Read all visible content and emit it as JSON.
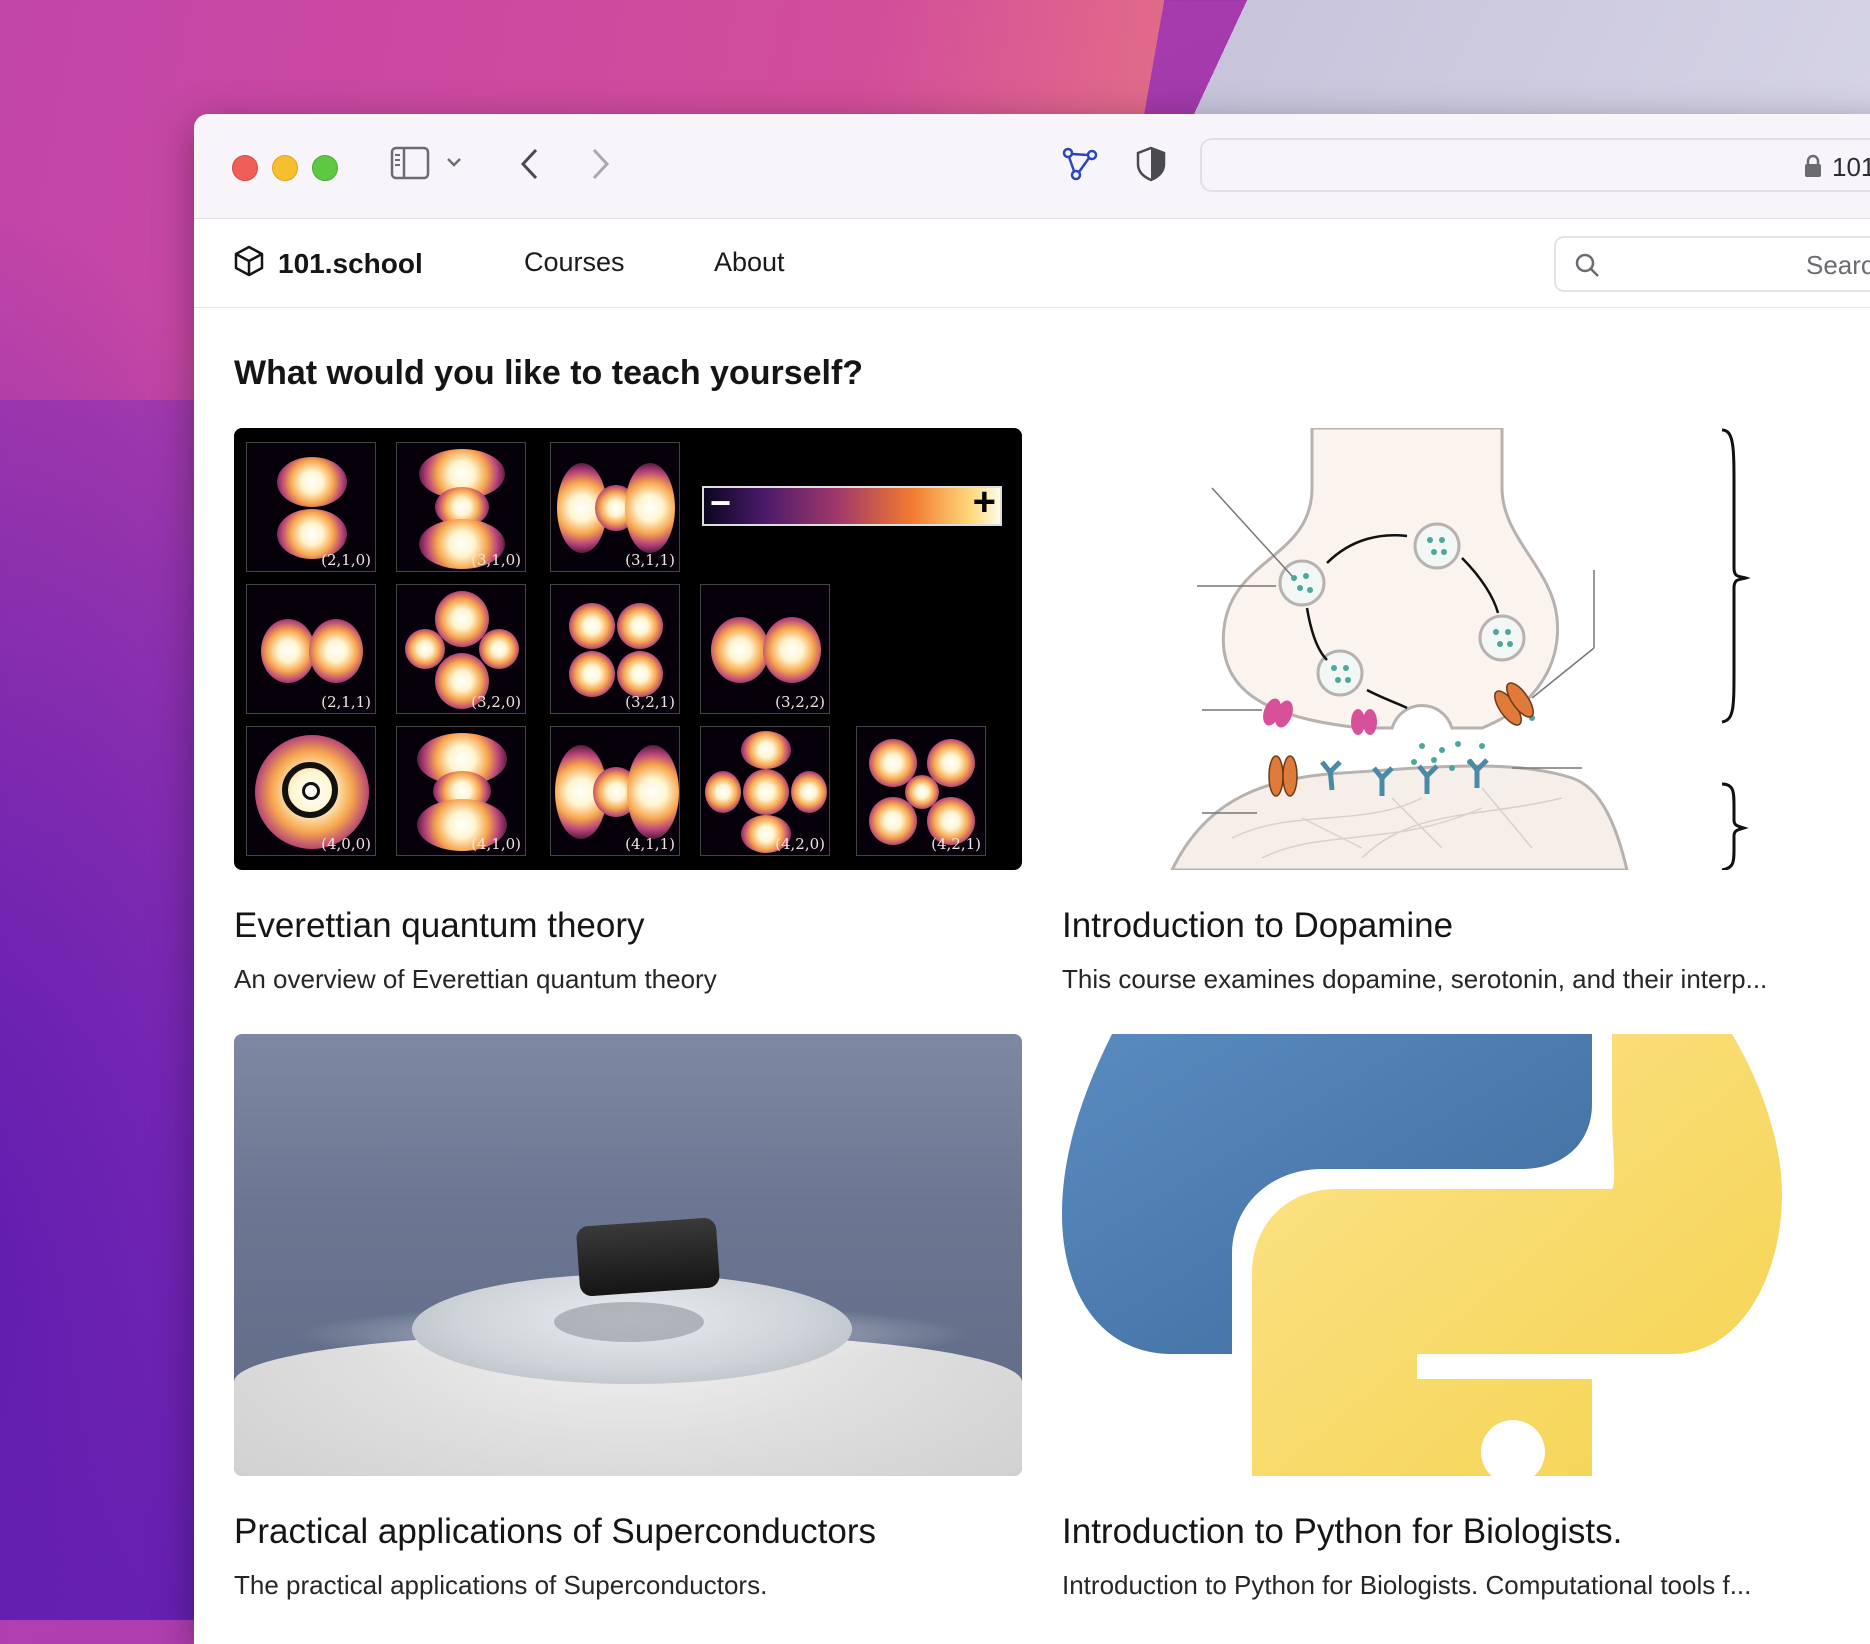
{
  "browser": {
    "address_text": "101",
    "icons": [
      "sidebar-icon",
      "chevron-down-icon",
      "back-icon",
      "forward-icon",
      "share-network-icon",
      "shield-icon",
      "lock-icon"
    ]
  },
  "nav": {
    "brand": "101.school",
    "links": [
      "Courses",
      "About"
    ],
    "search_placeholder": "Searc"
  },
  "main": {
    "heading": "What would you like to teach yourself?",
    "courses": [
      {
        "title": "Everettian quantum theory",
        "description": "An overview of Everettian quantum theory"
      },
      {
        "title": "Introduction to Dopamine",
        "description": "This course examines dopamine, serotonin, and their interp..."
      },
      {
        "title": "Practical applications of Superconductors",
        "description": "The practical applications of Superconductors."
      },
      {
        "title": "Introduction to Python for Biologists.",
        "description": "Introduction to Python for Biologists. Computational tools f..."
      }
    ],
    "orbital_labels": [
      "(2,1,0)",
      "(3,1,0)",
      "(3,1,1)",
      "(2,1,1)",
      "(3,2,0)",
      "(3,2,1)",
      "(3,2,2)",
      "(4,0,0)",
      "(4,1,0)",
      "(4,1,1)",
      "(4,2,0)",
      "(4,2,1)"
    ],
    "colorbar": {
      "minus": "−",
      "plus": "+"
    }
  },
  "colors": {
    "python_blue": "#4a77ab",
    "python_yellow": "#f7d85c",
    "dopamine_vesicle": "#4aa89b",
    "receptor_pink": "#d9509a",
    "channel_orange": "#e07a3a"
  }
}
